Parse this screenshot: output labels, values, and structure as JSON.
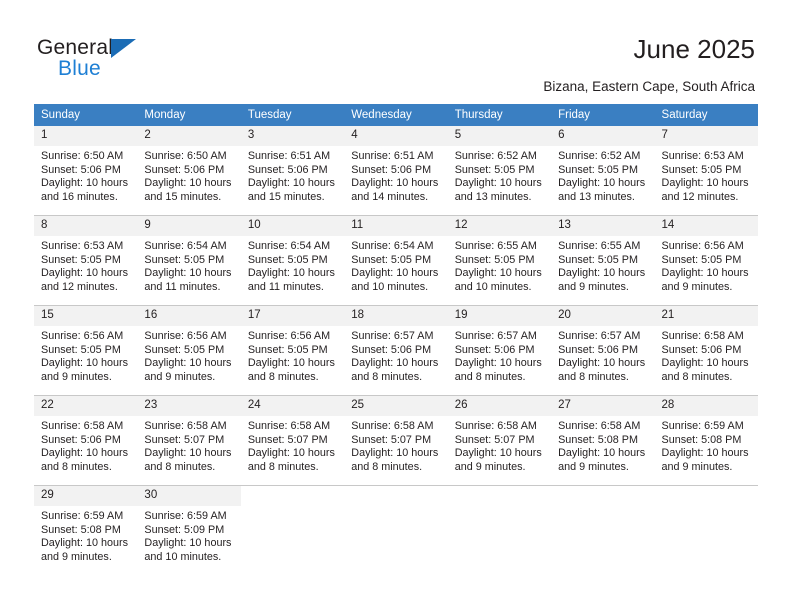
{
  "logo": {
    "word_top": "General",
    "word_bottom": "Blue",
    "triangle_color": "#1b6cb5",
    "blue_color": "#1e7fd4"
  },
  "header": {
    "title": "June 2025",
    "subtitle": "Bizana, Eastern Cape, South Africa"
  },
  "theme": {
    "header_row_bg": "#3a7fc2",
    "header_row_text": "#ffffff",
    "daynum_bg": "#f2f2f2",
    "cell_bg": "#ffffff",
    "grid_line": "#c8c8c8",
    "text": "#231f20"
  },
  "weekday_headers": [
    "Sunday",
    "Monday",
    "Tuesday",
    "Wednesday",
    "Thursday",
    "Friday",
    "Saturday"
  ],
  "weeks": [
    [
      {
        "day": "1",
        "sunrise": "Sunrise: 6:50 AM",
        "sunset": "Sunset: 5:06 PM",
        "daylight1": "Daylight: 10 hours",
        "daylight2": "and 16 minutes."
      },
      {
        "day": "2",
        "sunrise": "Sunrise: 6:50 AM",
        "sunset": "Sunset: 5:06 PM",
        "daylight1": "Daylight: 10 hours",
        "daylight2": "and 15 minutes."
      },
      {
        "day": "3",
        "sunrise": "Sunrise: 6:51 AM",
        "sunset": "Sunset: 5:06 PM",
        "daylight1": "Daylight: 10 hours",
        "daylight2": "and 15 minutes."
      },
      {
        "day": "4",
        "sunrise": "Sunrise: 6:51 AM",
        "sunset": "Sunset: 5:06 PM",
        "daylight1": "Daylight: 10 hours",
        "daylight2": "and 14 minutes."
      },
      {
        "day": "5",
        "sunrise": "Sunrise: 6:52 AM",
        "sunset": "Sunset: 5:05 PM",
        "daylight1": "Daylight: 10 hours",
        "daylight2": "and 13 minutes."
      },
      {
        "day": "6",
        "sunrise": "Sunrise: 6:52 AM",
        "sunset": "Sunset: 5:05 PM",
        "daylight1": "Daylight: 10 hours",
        "daylight2": "and 13 minutes."
      },
      {
        "day": "7",
        "sunrise": "Sunrise: 6:53 AM",
        "sunset": "Sunset: 5:05 PM",
        "daylight1": "Daylight: 10 hours",
        "daylight2": "and 12 minutes."
      }
    ],
    [
      {
        "day": "8",
        "sunrise": "Sunrise: 6:53 AM",
        "sunset": "Sunset: 5:05 PM",
        "daylight1": "Daylight: 10 hours",
        "daylight2": "and 12 minutes."
      },
      {
        "day": "9",
        "sunrise": "Sunrise: 6:54 AM",
        "sunset": "Sunset: 5:05 PM",
        "daylight1": "Daylight: 10 hours",
        "daylight2": "and 11 minutes."
      },
      {
        "day": "10",
        "sunrise": "Sunrise: 6:54 AM",
        "sunset": "Sunset: 5:05 PM",
        "daylight1": "Daylight: 10 hours",
        "daylight2": "and 11 minutes."
      },
      {
        "day": "11",
        "sunrise": "Sunrise: 6:54 AM",
        "sunset": "Sunset: 5:05 PM",
        "daylight1": "Daylight: 10 hours",
        "daylight2": "and 10 minutes."
      },
      {
        "day": "12",
        "sunrise": "Sunrise: 6:55 AM",
        "sunset": "Sunset: 5:05 PM",
        "daylight1": "Daylight: 10 hours",
        "daylight2": "and 10 minutes."
      },
      {
        "day": "13",
        "sunrise": "Sunrise: 6:55 AM",
        "sunset": "Sunset: 5:05 PM",
        "daylight1": "Daylight: 10 hours",
        "daylight2": "and 9 minutes."
      },
      {
        "day": "14",
        "sunrise": "Sunrise: 6:56 AM",
        "sunset": "Sunset: 5:05 PM",
        "daylight1": "Daylight: 10 hours",
        "daylight2": "and 9 minutes."
      }
    ],
    [
      {
        "day": "15",
        "sunrise": "Sunrise: 6:56 AM",
        "sunset": "Sunset: 5:05 PM",
        "daylight1": "Daylight: 10 hours",
        "daylight2": "and 9 minutes."
      },
      {
        "day": "16",
        "sunrise": "Sunrise: 6:56 AM",
        "sunset": "Sunset: 5:05 PM",
        "daylight1": "Daylight: 10 hours",
        "daylight2": "and 9 minutes."
      },
      {
        "day": "17",
        "sunrise": "Sunrise: 6:56 AM",
        "sunset": "Sunset: 5:05 PM",
        "daylight1": "Daylight: 10 hours",
        "daylight2": "and 8 minutes."
      },
      {
        "day": "18",
        "sunrise": "Sunrise: 6:57 AM",
        "sunset": "Sunset: 5:06 PM",
        "daylight1": "Daylight: 10 hours",
        "daylight2": "and 8 minutes."
      },
      {
        "day": "19",
        "sunrise": "Sunrise: 6:57 AM",
        "sunset": "Sunset: 5:06 PM",
        "daylight1": "Daylight: 10 hours",
        "daylight2": "and 8 minutes."
      },
      {
        "day": "20",
        "sunrise": "Sunrise: 6:57 AM",
        "sunset": "Sunset: 5:06 PM",
        "daylight1": "Daylight: 10 hours",
        "daylight2": "and 8 minutes."
      },
      {
        "day": "21",
        "sunrise": "Sunrise: 6:58 AM",
        "sunset": "Sunset: 5:06 PM",
        "daylight1": "Daylight: 10 hours",
        "daylight2": "and 8 minutes."
      }
    ],
    [
      {
        "day": "22",
        "sunrise": "Sunrise: 6:58 AM",
        "sunset": "Sunset: 5:06 PM",
        "daylight1": "Daylight: 10 hours",
        "daylight2": "and 8 minutes."
      },
      {
        "day": "23",
        "sunrise": "Sunrise: 6:58 AM",
        "sunset": "Sunset: 5:07 PM",
        "daylight1": "Daylight: 10 hours",
        "daylight2": "and 8 minutes."
      },
      {
        "day": "24",
        "sunrise": "Sunrise: 6:58 AM",
        "sunset": "Sunset: 5:07 PM",
        "daylight1": "Daylight: 10 hours",
        "daylight2": "and 8 minutes."
      },
      {
        "day": "25",
        "sunrise": "Sunrise: 6:58 AM",
        "sunset": "Sunset: 5:07 PM",
        "daylight1": "Daylight: 10 hours",
        "daylight2": "and 8 minutes."
      },
      {
        "day": "26",
        "sunrise": "Sunrise: 6:58 AM",
        "sunset": "Sunset: 5:07 PM",
        "daylight1": "Daylight: 10 hours",
        "daylight2": "and 9 minutes."
      },
      {
        "day": "27",
        "sunrise": "Sunrise: 6:58 AM",
        "sunset": "Sunset: 5:08 PM",
        "daylight1": "Daylight: 10 hours",
        "daylight2": "and 9 minutes."
      },
      {
        "day": "28",
        "sunrise": "Sunrise: 6:59 AM",
        "sunset": "Sunset: 5:08 PM",
        "daylight1": "Daylight: 10 hours",
        "daylight2": "and 9 minutes."
      }
    ],
    [
      {
        "day": "29",
        "sunrise": "Sunrise: 6:59 AM",
        "sunset": "Sunset: 5:08 PM",
        "daylight1": "Daylight: 10 hours",
        "daylight2": "and 9 minutes."
      },
      {
        "day": "30",
        "sunrise": "Sunrise: 6:59 AM",
        "sunset": "Sunset: 5:09 PM",
        "daylight1": "Daylight: 10 hours",
        "daylight2": "and 10 minutes."
      },
      {
        "day": "",
        "sunrise": "",
        "sunset": "",
        "daylight1": "",
        "daylight2": ""
      },
      {
        "day": "",
        "sunrise": "",
        "sunset": "",
        "daylight1": "",
        "daylight2": ""
      },
      {
        "day": "",
        "sunrise": "",
        "sunset": "",
        "daylight1": "",
        "daylight2": ""
      },
      {
        "day": "",
        "sunrise": "",
        "sunset": "",
        "daylight1": "",
        "daylight2": ""
      },
      {
        "day": "",
        "sunrise": "",
        "sunset": "",
        "daylight1": "",
        "daylight2": ""
      }
    ]
  ]
}
